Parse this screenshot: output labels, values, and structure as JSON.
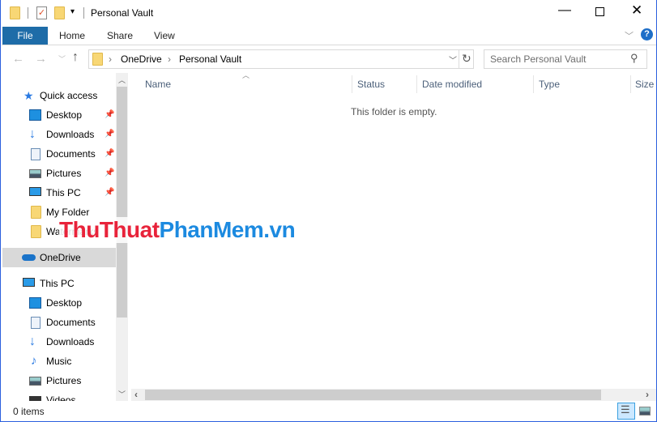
{
  "window": {
    "title": "Personal Vault"
  },
  "ribbon": {
    "tabs": [
      "File",
      "Home",
      "Share",
      "View"
    ]
  },
  "address": {
    "crumbs": [
      "OneDrive",
      "Personal Vault"
    ],
    "search_placeholder": "Search Personal Vault"
  },
  "nav": {
    "quick_access": "Quick access",
    "quick_items": [
      {
        "label": "Desktop",
        "icon": "desktop-icon"
      },
      {
        "label": "Downloads",
        "icon": "download-icon"
      },
      {
        "label": "Documents",
        "icon": "document-icon"
      },
      {
        "label": "Pictures",
        "icon": "pictures-icon"
      },
      {
        "label": "This PC",
        "icon": "computer-icon"
      },
      {
        "label": "My Folder",
        "icon": "folder-icon"
      },
      {
        "label": "Watermarks",
        "icon": "folder-icon"
      }
    ],
    "onedrive": "OneDrive",
    "this_pc": "This PC",
    "pc_items": [
      "Desktop",
      "Documents",
      "Downloads",
      "Music",
      "Pictures",
      "Videos"
    ]
  },
  "columns": [
    "Name",
    "Status",
    "Date modified",
    "Type",
    "Size"
  ],
  "empty_message": "This folder is empty.",
  "status": {
    "items": "0 items"
  },
  "watermark": "ThuThuatPhanMem.vn",
  "colors": {
    "accent": "#1e6ca8",
    "selected": "#d9d9d9",
    "window_border": "#2b60de"
  }
}
